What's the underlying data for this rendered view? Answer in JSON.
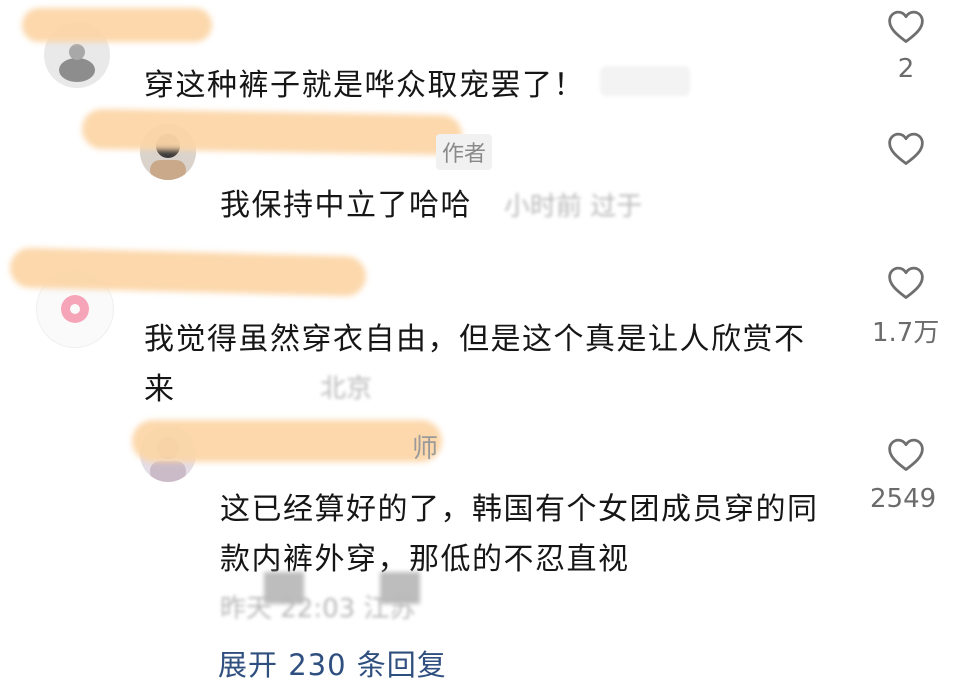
{
  "comments": [
    {
      "text": "穿这种裤子就是哗众取宠罢了！",
      "likes": "2"
    },
    {
      "author_badge": "作者",
      "text": "我保持中立了哈哈",
      "meta": "小时前 过于",
      "likes": ""
    },
    {
      "text_line1": "我觉得虽然穿衣自由，但是这个真是让人欣赏不",
      "text_line2": "来",
      "meta": "北京",
      "likes": "1.7万"
    },
    {
      "author_tail": "师",
      "text_line1": "这已经算好的了，韩国有个女团成员穿的同",
      "text_line2": "款内裤外穿，那低的不忍直视",
      "meta": "昨天 22:03 江苏",
      "likes": "2549"
    }
  ],
  "expand_replies": "展开 230 条回复",
  "colors": {
    "smudge": "#fcd6a8",
    "link": "#2f4f7f",
    "like_count": "#6b6b6b"
  },
  "icons": {
    "like": "heart-outline-icon"
  }
}
